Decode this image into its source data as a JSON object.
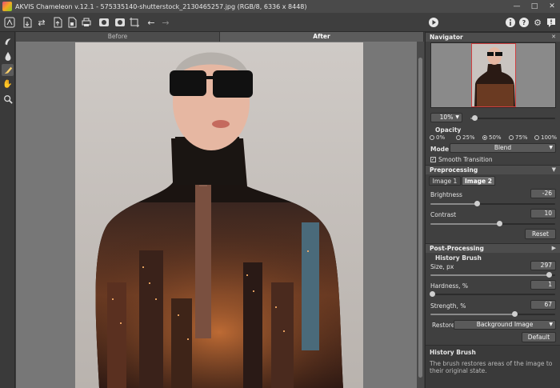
{
  "window": {
    "title": "AKVIS Chameleon v.12.1 - 575335140-shutterstock_2130465257.jpg (RGB/8, 6336 x 8448)"
  },
  "view_tabs": {
    "before": "Before",
    "after": "After"
  },
  "panel": {
    "navigator": {
      "title": "Navigator",
      "zoom": "10%",
      "zoom_slider": 0.05
    },
    "opacity": {
      "label": "Opacity",
      "options": [
        "0%",
        "25%",
        "50%",
        "75%",
        "100%"
      ],
      "selected": "50%"
    },
    "mode": {
      "label": "Mode",
      "value": "Blend"
    },
    "smooth_transition": {
      "label": "Smooth Transition",
      "checked": true
    },
    "preprocessing": {
      "title": "Preprocessing",
      "tabs": [
        "Image 1",
        "Image 2"
      ],
      "active_tab": "Image 2",
      "brightness": {
        "label": "Brightness",
        "value": "-26",
        "level": 0.37
      },
      "contrast": {
        "label": "Contrast",
        "value": "10",
        "level": 0.55
      },
      "reset": "Reset"
    },
    "postprocessing": {
      "title": "Post-Processing"
    },
    "history_brush": {
      "title": "History Brush",
      "size": {
        "label": "Size, px",
        "value": "297",
        "level": 0.95
      },
      "hardness": {
        "label": "Hardness, %",
        "value": "1",
        "level": 0.01
      },
      "strength": {
        "label": "Strength, %",
        "value": "67",
        "level": 0.67
      },
      "restore": {
        "label": "Restore",
        "value": "Background Image"
      },
      "default": "Default"
    },
    "help": {
      "title": "History Brush",
      "text": "The brush restores areas of the image to their original state."
    }
  },
  "icons": {
    "toolbar": [
      "app-logo-icon",
      "open-icon",
      "swap-images-icon",
      "save-icon",
      "save-as-icon",
      "print-icon",
      "load-image1-icon",
      "load-image2-icon",
      "crop-icon",
      "undo-icon",
      "redo-icon",
      "run-icon",
      "info-icon",
      "help-icon",
      "settings-icon",
      "messages-icon"
    ],
    "tools": [
      "selection-icon",
      "drop-icon",
      "history-brush-icon",
      "hand-icon",
      "zoom-icon"
    ]
  },
  "colors": {
    "accent": "#ffd36a",
    "panel": "#404040",
    "header": "#4d4d4d"
  }
}
